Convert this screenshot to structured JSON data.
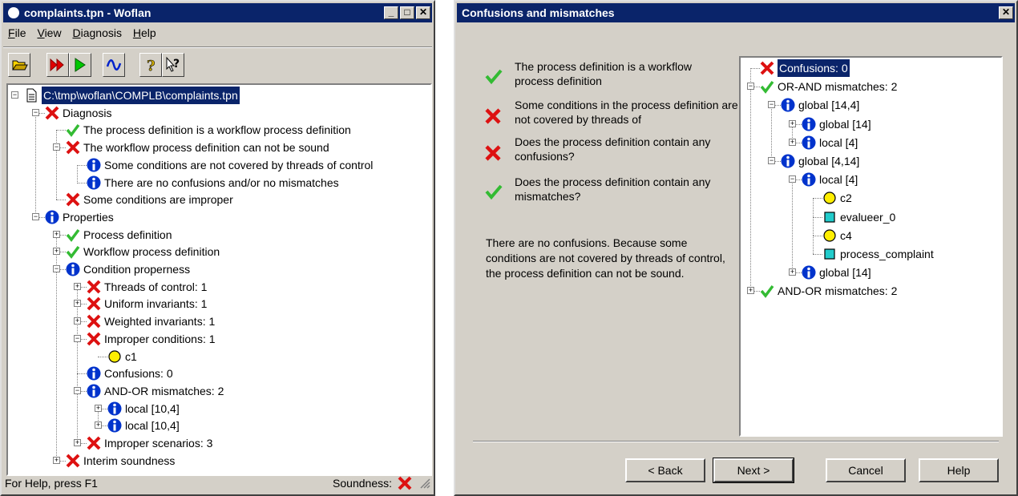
{
  "left_window": {
    "title": "complaints.tpn - Woflan",
    "menu": [
      "File",
      "View",
      "Diagnosis",
      "Help"
    ],
    "toolbar": [
      "open-icon",
      "run-all-icon",
      "run-icon",
      "wave-icon",
      "help-icon",
      "context-help-icon"
    ],
    "tree": [
      {
        "depth": 0,
        "icon": "doc",
        "text": "C:\\tmp\\woflan\\COMPLB\\complaints.tpn",
        "expander": "minus",
        "selected": true
      },
      {
        "depth": 1,
        "icon": "cross",
        "text": "Diagnosis",
        "expander": "minus"
      },
      {
        "depth": 2,
        "icon": "check",
        "text": "The process definition is a workflow process definition",
        "expander": ""
      },
      {
        "depth": 2,
        "icon": "cross",
        "text": "The workflow process definition can not be sound",
        "expander": "minus"
      },
      {
        "depth": 3,
        "icon": "info",
        "text": "Some conditions are not covered by threads of control",
        "expander": ""
      },
      {
        "depth": 3,
        "icon": "info",
        "text": "There are no confusions and/or no mismatches",
        "expander": ""
      },
      {
        "depth": 2,
        "icon": "cross",
        "text": "Some conditions are improper",
        "expander": ""
      },
      {
        "depth": 1,
        "icon": "info",
        "text": "Properties",
        "expander": "minus"
      },
      {
        "depth": 2,
        "icon": "check",
        "text": "Process definition",
        "expander": "plus"
      },
      {
        "depth": 2,
        "icon": "check",
        "text": "Workflow process definition",
        "expander": "plus"
      },
      {
        "depth": 2,
        "icon": "info",
        "text": "Condition properness",
        "expander": "minus"
      },
      {
        "depth": 3,
        "icon": "cross",
        "text": "Threads of control: 1",
        "expander": "plus"
      },
      {
        "depth": 3,
        "icon": "cross",
        "text": "Uniform invariants: 1",
        "expander": "plus"
      },
      {
        "depth": 3,
        "icon": "cross",
        "text": "Weighted invariants: 1",
        "expander": "plus"
      },
      {
        "depth": 3,
        "icon": "cross",
        "text": "Improper conditions: 1",
        "expander": "minus"
      },
      {
        "depth": 4,
        "icon": "circle",
        "text": "c1",
        "expander": ""
      },
      {
        "depth": 3,
        "icon": "info",
        "text": "Confusions: 0",
        "expander": ""
      },
      {
        "depth": 3,
        "icon": "info",
        "text": "AND-OR mismatches: 2",
        "expander": "minus"
      },
      {
        "depth": 4,
        "icon": "info",
        "text": "local [10,4]",
        "expander": "plus"
      },
      {
        "depth": 4,
        "icon": "info",
        "text": "local [10,4]",
        "expander": "plus"
      },
      {
        "depth": 3,
        "icon": "cross",
        "text": "Improper scenarios: 3",
        "expander": "plus"
      },
      {
        "depth": 2,
        "icon": "cross",
        "text": "Interim soundness",
        "expander": "plus"
      }
    ],
    "status_text": "For Help, press F1",
    "soundness_label": "Soundness:"
  },
  "right_window": {
    "title": "Confusions and mismatches",
    "checks": [
      {
        "icon": "check",
        "text": "The process definition is a workflow process definition"
      },
      {
        "icon": "cross",
        "text": "Some conditions in the process definition are not covered by threads of"
      },
      {
        "icon": "cross",
        "text": "Does the process definition contain any confusions?"
      },
      {
        "icon": "check",
        "text": "Does the process definition contain any mismatches?"
      }
    ],
    "explanation": "There are no confusions. Because some conditions are not covered by threads of control,  the process definition can not be sound.",
    "tree": [
      {
        "depth": 0,
        "icon": "cross",
        "text": "Confusions: 0",
        "expander": "",
        "selected": true
      },
      {
        "depth": 0,
        "icon": "check",
        "text": "OR-AND mismatches: 2",
        "expander": "minus"
      },
      {
        "depth": 1,
        "icon": "info",
        "text": "global [14,4]",
        "expander": "minus"
      },
      {
        "depth": 2,
        "icon": "info",
        "text": "global [14]",
        "expander": "plus"
      },
      {
        "depth": 2,
        "icon": "info",
        "text": "local [4]",
        "expander": "plus"
      },
      {
        "depth": 1,
        "icon": "info",
        "text": "global [4,14]",
        "expander": "minus"
      },
      {
        "depth": 2,
        "icon": "info",
        "text": "local [4]",
        "expander": "minus"
      },
      {
        "depth": 3,
        "icon": "circle",
        "text": "c2",
        "expander": ""
      },
      {
        "depth": 3,
        "icon": "square",
        "text": "evalueer_0",
        "expander": ""
      },
      {
        "depth": 3,
        "icon": "circle",
        "text": "c4",
        "expander": ""
      },
      {
        "depth": 3,
        "icon": "square",
        "text": "process_complaint",
        "expander": ""
      },
      {
        "depth": 2,
        "icon": "info",
        "text": "global [14]",
        "expander": "plus"
      },
      {
        "depth": 0,
        "icon": "check",
        "text": "AND-OR mismatches: 2",
        "expander": "plus"
      }
    ],
    "buttons": {
      "back": "< Back",
      "next": "Next >",
      "cancel": "Cancel",
      "help": "Help"
    }
  },
  "colors": {
    "titlebar": "#0a246a",
    "check": "#33bb33",
    "cross": "#dd1111",
    "info": "#0033cc",
    "circle": "#ffee00",
    "square": "#22cccc"
  }
}
